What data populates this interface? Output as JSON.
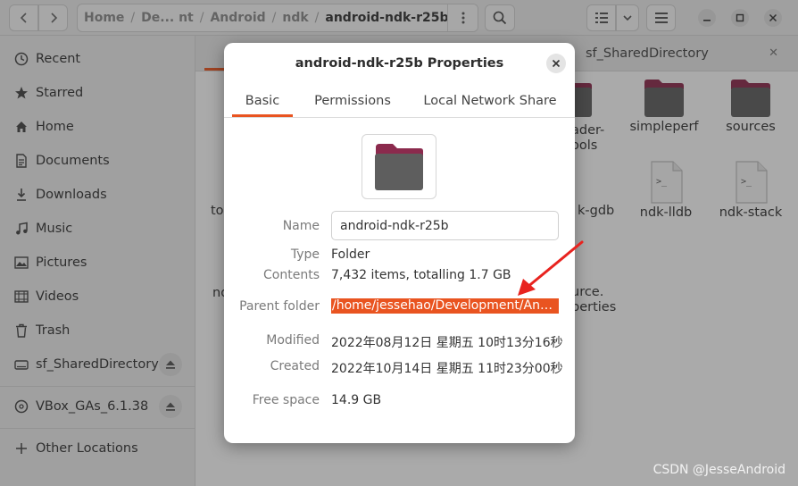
{
  "headerbar": {
    "breadcrumbs": [
      "Home",
      "De... nt",
      "Android",
      "ndk",
      "android-ndk-r25b"
    ],
    "crumb_sep": "/"
  },
  "sidebar": {
    "items": [
      {
        "label": "Recent",
        "icon": "clock-icon"
      },
      {
        "label": "Starred",
        "icon": "star-icon"
      },
      {
        "label": "Home",
        "icon": "home-icon"
      },
      {
        "label": "Documents",
        "icon": "document-icon"
      },
      {
        "label": "Downloads",
        "icon": "download-icon"
      },
      {
        "label": "Music",
        "icon": "music-icon"
      },
      {
        "label": "Pictures",
        "icon": "picture-icon"
      },
      {
        "label": "Videos",
        "icon": "video-icon"
      },
      {
        "label": "Trash",
        "icon": "trash-icon"
      },
      {
        "label": "sf_SharedDirectory",
        "icon": "drive-icon"
      },
      {
        "label": "VBox_GAs_6.1.38",
        "icon": "disc-icon"
      },
      {
        "label": "Other Locations",
        "icon": "plus-icon"
      }
    ]
  },
  "main": {
    "tab2_label": "sf_SharedDirectory",
    "files_row1": [
      {
        "label": "ader-\nools"
      },
      {
        "label": "simpleperf"
      },
      {
        "label": "sources"
      }
    ],
    "files_row2": [
      {
        "label": "k-gdb"
      },
      {
        "label": "ndk-lldb"
      },
      {
        "label": "ndk-stack"
      }
    ],
    "file_row3": {
      "label": "urce.\nperties"
    },
    "left_frag1": "to",
    "left_frag2": "nd"
  },
  "dialog": {
    "title": "android-ndk-r25b Properties",
    "tabs": [
      "Basic",
      "Permissions",
      "Local Network Share"
    ],
    "active_tab": "Basic",
    "name_label": "Name",
    "name_value": "android-ndk-r25b",
    "type_label": "Type",
    "type_value": "Folder",
    "contents_label": "Contents",
    "contents_value": "7,432 items, totalling 1.7 GB",
    "parent_label": "Parent folder",
    "parent_value": "/home/jessehao/Development/And…",
    "modified_label": "Modified",
    "modified_value": "2022年08月12日 星期五 10时13分16秒",
    "created_label": "Created",
    "created_value": "2022年10月14日 星期五 11时23分00秒",
    "free_label": "Free space",
    "free_value": "14.9 GB"
  },
  "watermark": "CSDN @JesseAndroid",
  "colors": {
    "accent": "#e95420",
    "folder_tab": "#8b2a4d",
    "folder_body": "#5e5e5e",
    "annotation_arrow": "#e8231f"
  }
}
